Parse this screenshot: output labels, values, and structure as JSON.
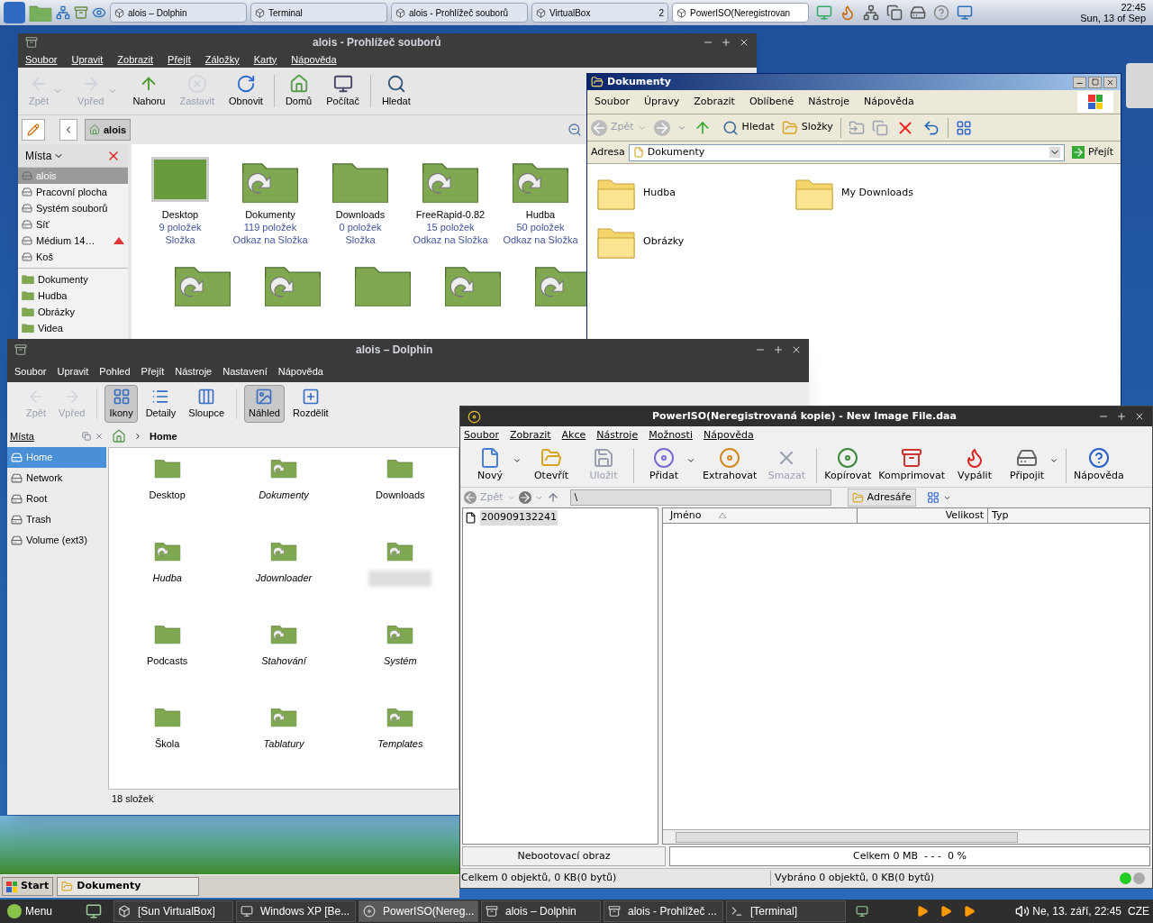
{
  "top_panel": {
    "tasks": [
      {
        "label": "alois – Dolphin",
        "selected": false
      },
      {
        "label": "Terminal",
        "selected": false
      },
      {
        "label": "alois - Prohlížeč souborů",
        "selected": false
      },
      {
        "label": "VirtualBox",
        "selected": false,
        "count": "2"
      },
      {
        "label": "PowerISO(Neregistrovan",
        "selected": true
      }
    ],
    "clock": {
      "time": "22:45",
      "date": "Sun, 13 of Sep"
    }
  },
  "konqueror": {
    "title": "alois - Prohlížeč souborů",
    "menu": [
      "Soubor",
      "Upravit",
      "Zobrazit",
      "Přejít",
      "Záložky",
      "Karty",
      "Nápověda"
    ],
    "toolbar": [
      {
        "label": "Zpět",
        "disabled": true,
        "dropdown": true
      },
      {
        "label": "Vpřed",
        "disabled": true,
        "dropdown": true
      },
      {
        "label": "Nahoru",
        "disabled": false,
        "dropdown": false
      },
      {
        "label": "Zastavit",
        "disabled": true,
        "dropdown": false
      },
      {
        "label": "Obnovit",
        "disabled": false,
        "dropdown": false
      },
      {
        "label": "Domů",
        "disabled": false,
        "dropdown": false
      },
      {
        "label": "Počítač",
        "disabled": false,
        "dropdown": false
      },
      {
        "label": "Hledat",
        "disabled": false,
        "dropdown": false
      }
    ],
    "location": "alois",
    "places_title": "Místa",
    "places": [
      {
        "label": "alois",
        "selected": true,
        "eject": false
      },
      {
        "label": "Pracovní plocha",
        "selected": false,
        "eject": false
      },
      {
        "label": "Systém souborů",
        "selected": false,
        "eject": false
      },
      {
        "label": "Síť",
        "selected": false,
        "eject": false
      },
      {
        "label": "Médium 14…",
        "selected": false,
        "eject": true
      },
      {
        "label": "Koš",
        "selected": false,
        "eject": false
      }
    ],
    "folders": [
      "Dokumenty",
      "Hudba",
      "Obrázky",
      "Videa"
    ],
    "files": [
      {
        "name": "Desktop",
        "count": "9 položek",
        "type": "Složka",
        "kind": "desktop"
      },
      {
        "name": "Dokumenty",
        "count": "119 položek",
        "type": "Odkaz na Složka",
        "kind": "link"
      },
      {
        "name": "Downloads",
        "count": "0 položek",
        "type": "Složka",
        "kind": "folder"
      },
      {
        "name": "FreeRapid-0.82",
        "count": "15 položek",
        "type": "Odkaz na Složka",
        "kind": "link"
      },
      {
        "name": "Hudba",
        "count": "50 položek",
        "type": "Odkaz na Složka",
        "kind": "link"
      }
    ]
  },
  "xp": {
    "title": "Dokumenty",
    "menu": [
      "Soubor",
      "Úpravy",
      "Zobrazit",
      "Oblíbené",
      "Nástroje",
      "Nápověda"
    ],
    "toolbar": [
      {
        "label": "Zpět"
      },
      {
        "label": "Hledat"
      },
      {
        "label": "Složky"
      }
    ],
    "address_label": "Adresa",
    "address": "Dokumenty",
    "go": "Přejít",
    "items": [
      {
        "name": "Hudba"
      },
      {
        "name": "My Downloads"
      },
      {
        "name": "Obrázky"
      }
    ]
  },
  "dolphin": {
    "title": "alois – Dolphin",
    "menu": [
      "Soubor",
      "Upravit",
      "Pohled",
      "Přejít",
      "Nástroje",
      "Nastavení",
      "Nápověda"
    ],
    "toolbar": [
      {
        "label": "Zpět",
        "disabled": true,
        "selected": false
      },
      {
        "label": "Vpřed",
        "disabled": true,
        "selected": false
      },
      {
        "label": "Ikony",
        "disabled": false,
        "selected": true
      },
      {
        "label": "Detaily",
        "disabled": false,
        "selected": false
      },
      {
        "label": "Sloupce",
        "disabled": false,
        "selected": false
      },
      {
        "label": "Náhled",
        "disabled": false,
        "selected": true
      },
      {
        "label": "Rozdělit",
        "disabled": false,
        "selected": false
      }
    ],
    "places_title": "Místa",
    "places": [
      {
        "label": "Home",
        "selected": true
      },
      {
        "label": "Network",
        "selected": false
      },
      {
        "label": "Root",
        "selected": false
      },
      {
        "label": "Trash",
        "selected": false
      },
      {
        "label": "Volume (ext3)",
        "selected": false
      }
    ],
    "breadcrumb": "Home",
    "items": [
      {
        "name": "Desktop",
        "kind": "folder"
      },
      {
        "name": "Dokumenty",
        "kind": "link"
      },
      {
        "name": "Downloads",
        "kind": "folder"
      },
      {
        "name": "Hudba",
        "kind": "link"
      },
      {
        "name": "Jdownloader",
        "kind": "link"
      },
      {
        "kind": "link",
        "blurred": true
      },
      {
        "name": "Podcasts",
        "kind": "folder"
      },
      {
        "name": "Stahování",
        "kind": "link"
      },
      {
        "name": "Systém",
        "kind": "link"
      },
      {
        "name": "Škola",
        "kind": "folder"
      },
      {
        "name": "Tablatury",
        "kind": "link"
      },
      {
        "name": "Templates",
        "kind": "link"
      }
    ],
    "status": "18 složek"
  },
  "poweriso": {
    "title": "PowerISO(Neregistrovaná kopie) - New Image File.daa",
    "menu": [
      "Soubor",
      "Zobrazit",
      "Akce",
      "Nástroje",
      "Možnosti",
      "Nápověda"
    ],
    "toolbar": [
      {
        "label": "Nový",
        "disabled": false,
        "dropdown": true
      },
      {
        "label": "Otevřít",
        "disabled": false,
        "dropdown": false
      },
      {
        "label": "Uložit",
        "disabled": true,
        "dropdown": false
      },
      {
        "label": "Přidat",
        "disabled": false,
        "dropdown": true
      },
      {
        "label": "Extrahovat",
        "disabled": false,
        "dropdown": false
      },
      {
        "label": "Smazat",
        "disabled": true,
        "dropdown": false
      },
      {
        "label": "Kopírovat",
        "disabled": false,
        "dropdown": false
      },
      {
        "label": "Komprimovat",
        "disabled": false,
        "dropdown": false
      },
      {
        "label": "Vypálit",
        "disabled": false,
        "dropdown": false
      },
      {
        "label": "Připojit",
        "disabled": false,
        "dropdown": true
      },
      {
        "label": "Nápověda",
        "disabled": false,
        "dropdown": false
      }
    ],
    "back": "Zpět",
    "path": "\\",
    "dirs": "Adresáře",
    "tree": [
      {
        "label": "200909132241",
        "selected": true
      }
    ],
    "columns": [
      "Jméno",
      "Velikost",
      "Typ"
    ],
    "status_type": "Nebootovací obraz",
    "status_total": "Celkem 0 MB  - - -  0 %",
    "status_left": "Celkem 0 objektů, 0 KB(0 bytů)",
    "status_right": "Vybráno 0 objektů, 0 KB(0 bytů)"
  },
  "xp_taskbar": {
    "start": "Start",
    "tasks": [
      "Dokumenty"
    ]
  },
  "bottom_panel": {
    "menu": "Menu",
    "tasks": [
      {
        "label": "[Sun VirtualBox]",
        "selected": false
      },
      {
        "label": "Windows XP [Be...",
        "selected": false
      },
      {
        "label": "PowerISO(Nereg...",
        "selected": true
      },
      {
        "label": "alois – Dolphin",
        "selected": false
      },
      {
        "label": "alois - Prohlížeč ...",
        "selected": false
      },
      {
        "label": "[Terminal]",
        "selected": false
      }
    ],
    "clock": "Ne, 13. září, 22:45",
    "layout": "CZE"
  }
}
